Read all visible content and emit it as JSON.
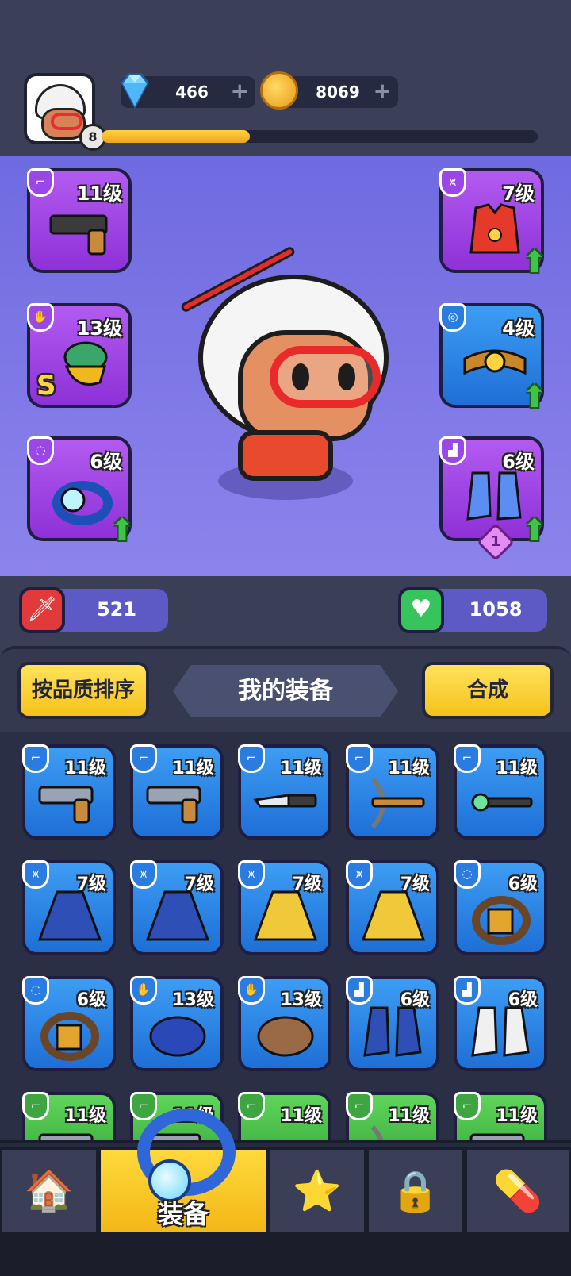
{
  "header": {
    "player_level": "8",
    "xp_progress": 0.34,
    "gems": "466",
    "coins": "8069",
    "plus_symbol": "+"
  },
  "equipped": {
    "weapon": {
      "level": "11级",
      "icon": "pistol-icon"
    },
    "armor": {
      "level": "7级",
      "icon": "red-vest-icon"
    },
    "gloves": {
      "level": "13级",
      "icon": "gold-gauntlet-icon",
      "grade": "S"
    },
    "belt": {
      "level": "4级",
      "icon": "gold-belt-icon"
    },
    "ring": {
      "level": "6级",
      "icon": "blue-ring-icon"
    },
    "boots": {
      "level": "6级",
      "icon": "blue-boots-icon",
      "count": "1"
    }
  },
  "stats": {
    "attack": "521",
    "health": "1058"
  },
  "inventory": {
    "sort_button": "按品质排序",
    "title": "我的装备",
    "merge_button": "合成",
    "items": [
      {
        "level": "11级",
        "color": "blue",
        "icon": "pistol-icon",
        "type": "weapon"
      },
      {
        "level": "11级",
        "color": "blue",
        "icon": "pistol-icon",
        "type": "weapon"
      },
      {
        "level": "11级",
        "color": "blue",
        "icon": "knife-icon",
        "type": "weapon"
      },
      {
        "level": "11级",
        "color": "blue",
        "icon": "crossbow-icon",
        "type": "weapon"
      },
      {
        "level": "11级",
        "color": "blue",
        "icon": "wand-icon",
        "type": "weapon"
      },
      {
        "level": "7级",
        "color": "blue",
        "icon": "blue-coat-icon",
        "type": "armor"
      },
      {
        "level": "7级",
        "color": "blue",
        "icon": "blue-coat-icon",
        "type": "armor"
      },
      {
        "level": "7级",
        "color": "blue",
        "icon": "yellow-coat-icon",
        "type": "armor"
      },
      {
        "level": "7级",
        "color": "blue",
        "icon": "yellow-coat-icon",
        "type": "armor"
      },
      {
        "level": "6级",
        "color": "blue",
        "icon": "brown-ring-icon",
        "type": "ring"
      },
      {
        "level": "6级",
        "color": "blue",
        "icon": "brown-ring-icon",
        "type": "ring"
      },
      {
        "level": "13级",
        "color": "blue",
        "icon": "blue-gloves-icon",
        "type": "gloves"
      },
      {
        "level": "13级",
        "color": "blue",
        "icon": "brown-gloves-icon",
        "type": "gloves"
      },
      {
        "level": "6级",
        "color": "blue",
        "icon": "blue-boots-icon",
        "type": "boots"
      },
      {
        "level": "6级",
        "color": "blue",
        "icon": "white-boots-icon",
        "type": "boots"
      },
      {
        "level": "11级",
        "color": "green",
        "icon": "pistol-icon",
        "type": "weapon"
      },
      {
        "level": "11级",
        "color": "green",
        "icon": "pistol-icon",
        "type": "weapon"
      },
      {
        "level": "11级",
        "color": "green",
        "icon": "knife-icon",
        "type": "weapon"
      },
      {
        "level": "11级",
        "color": "green",
        "icon": "crossbow-icon",
        "type": "weapon"
      },
      {
        "level": "11级",
        "color": "green",
        "icon": "pistol-icon",
        "type": "weapon"
      }
    ]
  },
  "tabbar": {
    "tabs": [
      {
        "icon": "shop-icon",
        "label": ""
      },
      {
        "icon": "ring-icon",
        "label": "装备",
        "active": true
      },
      {
        "icon": "star-guns-icon",
        "label": ""
      },
      {
        "icon": "lock-icon",
        "label": ""
      },
      {
        "icon": "capsule-icon",
        "label": ""
      }
    ]
  },
  "colors": {
    "purple": "#9b46e6",
    "blue": "#2b7ce0",
    "green": "#3da641",
    "accent_yellow": "#f5c21b"
  }
}
